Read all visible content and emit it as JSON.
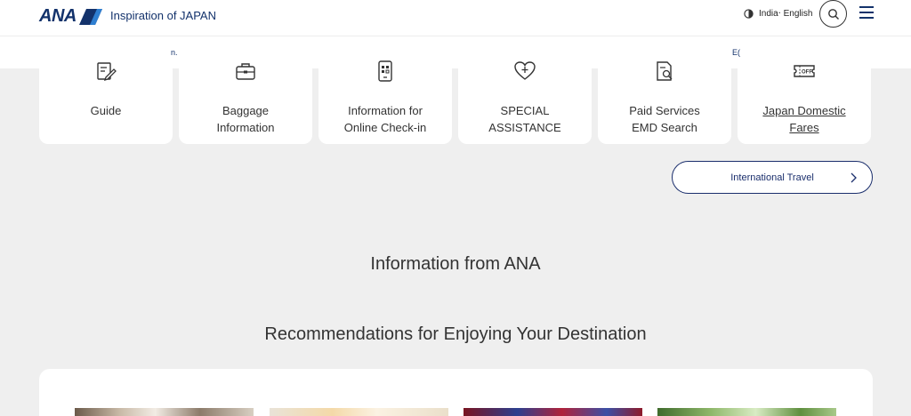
{
  "header": {
    "logo_text": "ANA",
    "tagline": "Inspiration of JAPAN",
    "region_label": "India‧ English",
    "icons": [
      "globe-icon",
      "search-icon",
      "menu-icon"
    ]
  },
  "subbar": {
    "fragment_left": "n.",
    "fragment_right": "E("
  },
  "cards": [
    {
      "label": "Guide",
      "icon": "guide-icon"
    },
    {
      "label": "Baggage\nInformation",
      "icon": "baggage-icon"
    },
    {
      "label": "Information for\nOnline Check-in",
      "icon": "qr-phone-icon"
    },
    {
      "label": "SPECIAL\nASSISTANCE",
      "icon": "heart-plus-icon"
    },
    {
      "label": "Paid Services\nEMD Search",
      "icon": "document-search-icon"
    },
    {
      "label": "Japan Domestic\nFares",
      "icon": "ticket-off-icon"
    }
  ],
  "international_button": {
    "label": "International Travel",
    "icon": "chevron-right-icon"
  },
  "headings": {
    "info": "Information from ANA",
    "recommendations": "Recommendations for Enjoying Your Destination"
  },
  "colors": {
    "brand": "#13326b",
    "page_bg": "#efefef"
  }
}
